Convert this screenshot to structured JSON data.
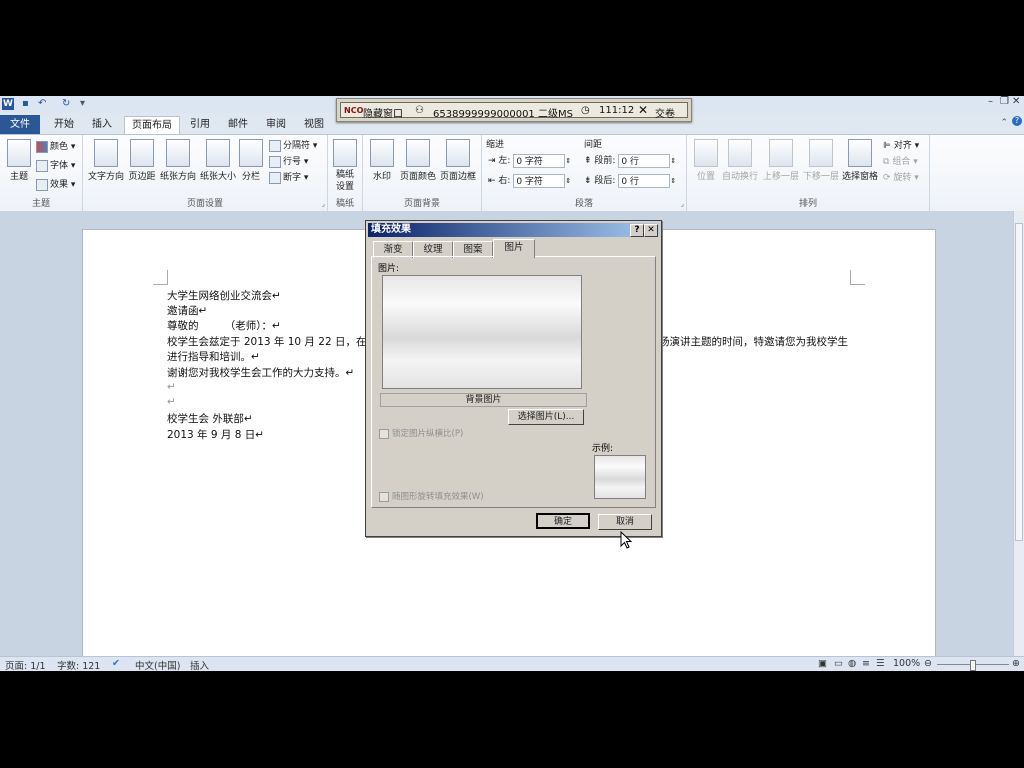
{
  "app": {
    "logo": "W"
  },
  "exam_bar": {
    "logo": "NCO",
    "hide_window": "隐藏窗口",
    "candidate_id": "6538999999000001 二级MS",
    "timer": "111:12",
    "submit": "交卷"
  },
  "tabs": [
    "文件",
    "开始",
    "插入",
    "页面布局",
    "引用",
    "邮件",
    "审阅",
    "视图"
  ],
  "ribbon": {
    "theme": {
      "themes": "主题",
      "colors": "颜色",
      "fonts": "字体",
      "effects": "效果",
      "label": "主题"
    },
    "page_setup": {
      "text_dir": "文字方向",
      "margins": "页边距",
      "orientation": "纸张方向",
      "size": "纸张大小",
      "columns": "分栏",
      "breaks": "分隔符",
      "line_numbers": "行号",
      "hyphenation": "断字",
      "label": "页面设置"
    },
    "manuscript": {
      "setup": "稿纸\n设置",
      "label": "稿纸"
    },
    "page_bg": {
      "watermark": "水印",
      "page_color": "页面颜色",
      "page_border": "页面边框",
      "label": "页面背景"
    },
    "paragraph": {
      "indent": "缩进",
      "left": "左:",
      "right": "右:",
      "left_val": "0 字符",
      "right_val": "0 字符",
      "spacing": "间距",
      "before": "段前:",
      "after": "段后:",
      "before_val": "0 行",
      "after_val": "0 行",
      "label": "段落"
    },
    "arrange": {
      "position": "位置",
      "wrap": "自动换行",
      "forward": "上移一层",
      "backward": "下移一层",
      "selection": "选择窗格",
      "align": "对齐",
      "group": "组合",
      "rotate": "旋转",
      "label": "排列"
    }
  },
  "document": {
    "lines": [
      "大学生网络创业交流会↵",
      "邀请函↵",
      "尊敬的　　　（老师）：↵",
      "校学生会兹定于 2013 年 10 月 22 日，在本",
      "进行指导和培训。↵",
      "谢谢您对我校学生会工作的大力支持。↵",
      "↵",
      "↵",
      "校学生会 外联部↵",
      "2013 年 9 月 8 日↵"
    ],
    "line_right": "扬演讲主题的时间，特邀请您为我校学生"
  },
  "status": {
    "page": "页面: 1/1",
    "words": "字数: 121",
    "lang": "中文(中国)",
    "mode": "插入",
    "zoom": "100%"
  },
  "dialog": {
    "title": "填充效果",
    "tabs": [
      "渐变",
      "纹理",
      "图案",
      "图片"
    ],
    "picture_label": "图片:",
    "picture_caption": "背景图片",
    "select_btn": "选择图片(L)...",
    "lock_ratio": "锁定图片纵横比(P)",
    "rotate_fill": "随图形旋转填充效果(W)",
    "sample_label": "示例:",
    "ok": "确定",
    "cancel": "取消"
  }
}
